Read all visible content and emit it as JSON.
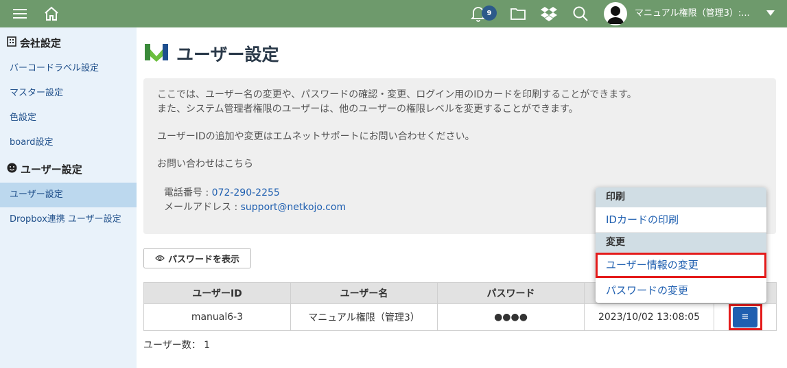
{
  "topbar": {
    "notification_count": "9",
    "user_name": "マニュアル権限（管理3）:..."
  },
  "sidebar": {
    "sections": [
      {
        "label": "会社設定",
        "icon": "building-icon",
        "items": [
          "バーコードラベル設定",
          "マスター設定",
          "色設定",
          "board設定"
        ]
      },
      {
        "label": "ユーザー設定",
        "icon": "smiley-icon",
        "items": [
          "ユーザー設定",
          "Dropbox連携 ユーザー設定"
        ]
      }
    ],
    "active_item": "ユーザー設定"
  },
  "main": {
    "title": "ユーザー設定",
    "info": {
      "line1": "ここでは、ユーザー名の変更や、パスワードの確認・変更、ログイン用のIDカードを印刷することができます。",
      "line2": "また、システム管理者権限のユーザーは、他のユーザーの権限レベルを変更することができます。",
      "line3": "ユーザーIDの追加や変更はエムネットサポートにお問い合わせください。",
      "line4": "お問い合わせはこちら",
      "phone_label": "電話番号 : ",
      "phone": "072-290-2255",
      "email_label": "メールアドレス : ",
      "email": "support@netkojo.com"
    },
    "show_password_button": "パスワードを表示",
    "table": {
      "headers": [
        "ユーザーID",
        "ユーザー名",
        "パスワード",
        "",
        ""
      ],
      "rows": [
        {
          "user_id": "manual6-3",
          "user_name": "マニュアル権限（管理3）",
          "password": "●●●●",
          "updated": "2023/10/02 13:08:05",
          "menu": "≡"
        }
      ]
    },
    "user_count": "ユーザー数： 1"
  },
  "dropdown": {
    "sections": [
      {
        "header": "印刷",
        "items": [
          "IDカードの印刷"
        ]
      },
      {
        "header": "変更",
        "items": [
          "ユーザー情報の変更",
          "パスワードの変更"
        ]
      }
    ]
  },
  "colors": {
    "topbar": "#6e9a6c",
    "sidebar": "#e9f2fa",
    "sidebar_active": "#bcd8ee",
    "link": "#1f5fb0",
    "highlight": "#e41b1b"
  }
}
